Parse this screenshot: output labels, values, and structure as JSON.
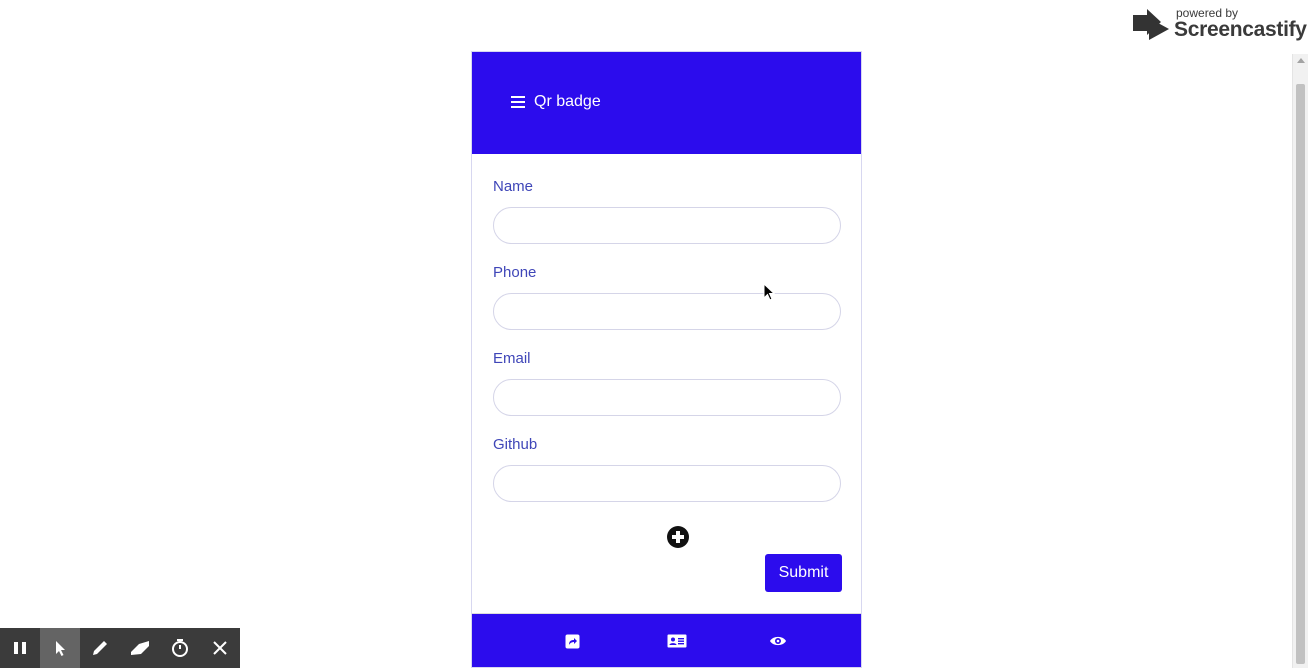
{
  "watermark": {
    "powered_by": "powered by",
    "brand": "Screencastify"
  },
  "app": {
    "title": "Qr badge",
    "menu_icon": "hamburger-menu-icon",
    "fields": [
      {
        "label": "Name",
        "value": "",
        "placeholder": ""
      },
      {
        "label": "Phone",
        "value": "",
        "placeholder": ""
      },
      {
        "label": "Email",
        "value": "",
        "placeholder": ""
      },
      {
        "label": "Github",
        "value": "",
        "placeholder": ""
      }
    ],
    "add_icon": "plus-circle-icon",
    "submit_label": "Submit",
    "bottom_nav": [
      "share-icon",
      "id-card-icon",
      "eye-icon"
    ]
  },
  "toolbar": {
    "buttons": [
      "pause-icon",
      "pointer-icon",
      "pen-icon",
      "eraser-icon",
      "timer-icon",
      "close-icon"
    ]
  },
  "colors": {
    "primary": "#2c0ced",
    "label": "#3f46b8",
    "toolbar": "#3b3b3b"
  }
}
